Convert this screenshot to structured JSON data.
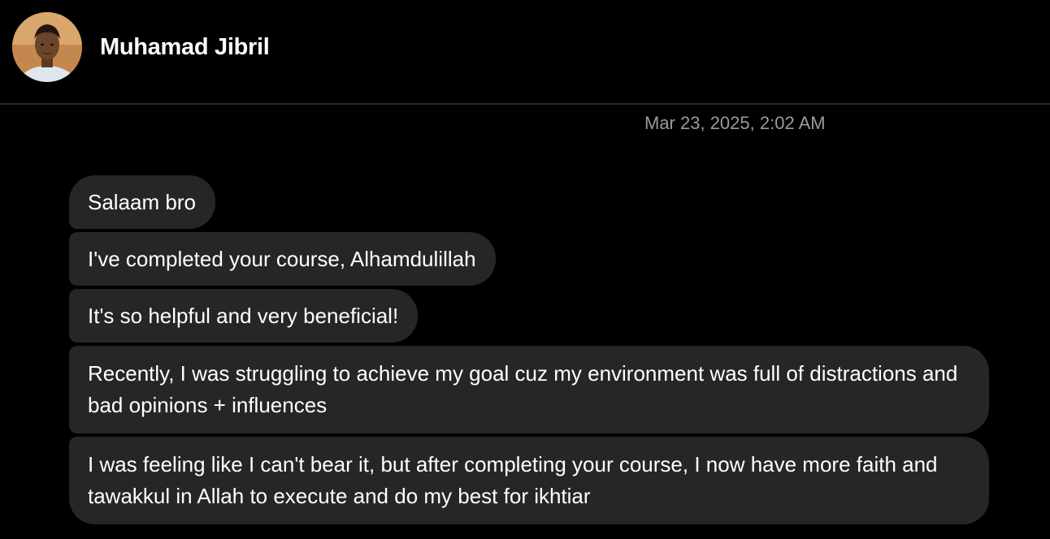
{
  "header": {
    "contact_name": "Muhamad Jibril",
    "avatar_icon": "profile-photo"
  },
  "thread": {
    "timestamp": "Mar 23, 2025, 2:02 AM",
    "messages": [
      "Salaam bro",
      "I've completed your course, Alhamdulillah",
      "It's so helpful and very beneficial!",
      "Recently, I was struggling to achieve my goal cuz my environment was full of distractions and bad opinions + influences",
      "I was feeling like I can't bear it, but after completing your course, I now have more faith and tawakkul in Allah to execute and do my best for ikhtiar"
    ]
  },
  "colors": {
    "background": "#000000",
    "bubble": "#262628",
    "timestamp": "#9a9a9f",
    "divider": "#2a2a2c"
  }
}
